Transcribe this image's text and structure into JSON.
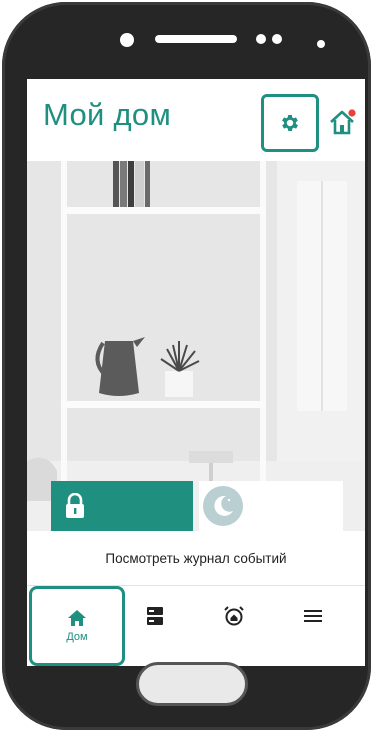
{
  "header": {
    "title": "Мой дом"
  },
  "events": {
    "link_label": "Посмотреть журнал событий"
  },
  "nav": {
    "home_label": "Дом"
  },
  "colors": {
    "accent": "#1f8f80",
    "alert": "#e8403a",
    "muted_icon": "#b9cfd2"
  },
  "icons": {
    "settings": "gear-icon",
    "home_alert": "home-alert-icon",
    "lock": "lock-icon",
    "night": "moon-icon",
    "alarm": "alarm-clock-icon",
    "devices": "devices-icon",
    "menu": "menu-icon"
  }
}
